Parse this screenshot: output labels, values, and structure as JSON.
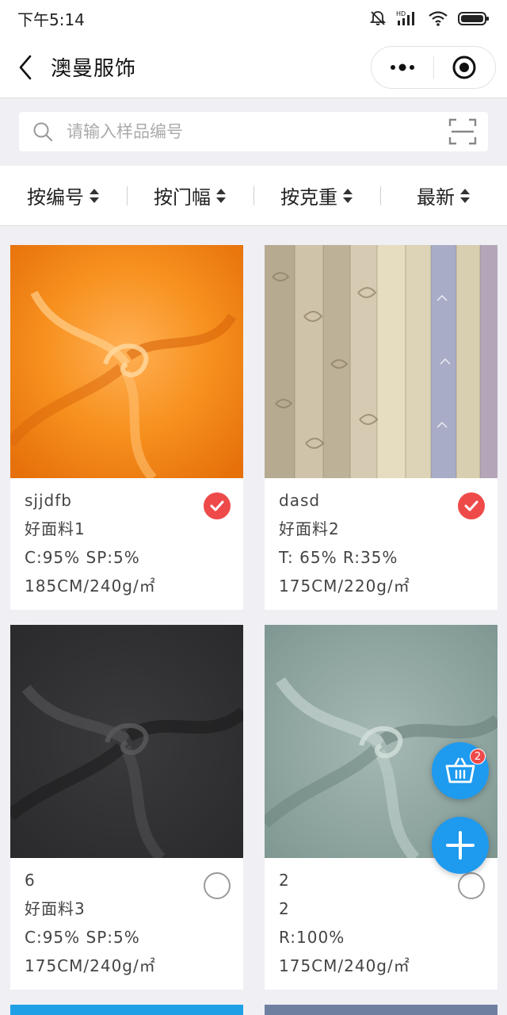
{
  "status": {
    "time": "下午5:14",
    "hd_label": "HD"
  },
  "nav": {
    "title": "澳曼服饰"
  },
  "search": {
    "placeholder": "请输入样品编号",
    "value": ""
  },
  "sort": [
    {
      "label": "按编号"
    },
    {
      "label": "按门幅"
    },
    {
      "label": "按克重"
    },
    {
      "label": "最新"
    }
  ],
  "products": [
    {
      "code": "sjjdfb",
      "name": "好面料1",
      "composition": "C:95% SP:5%",
      "spec": "185CM/240g/㎡",
      "selected": true,
      "swatch": "orange-velvet"
    },
    {
      "code": "dasd",
      "name": "好面料2",
      "composition": "T: 65% R:35%",
      "spec": "175CM/220g/㎡",
      "selected": true,
      "swatch": "printed-panels"
    },
    {
      "code": "6",
      "name": "好面料3",
      "composition": "C:95% SP:5%",
      "spec": "175CM/240g/㎡",
      "selected": false,
      "swatch": "charcoal-knit"
    },
    {
      "code": "2",
      "name": "2",
      "composition": "R:100%",
      "spec": "175CM/240g/㎡",
      "selected": false,
      "swatch": "sage-knit"
    }
  ],
  "cart": {
    "badge": "2"
  },
  "icons": {
    "back": "chevron-left-icon",
    "more": "more-dots-icon",
    "close": "target-icon",
    "search": "search-icon",
    "scan": "scan-icon",
    "cart": "basket-icon",
    "add": "plus-icon"
  },
  "colors": {
    "accent": "#1e9aef",
    "check": "#ef4a4a",
    "badge": "#ef4a4a"
  }
}
